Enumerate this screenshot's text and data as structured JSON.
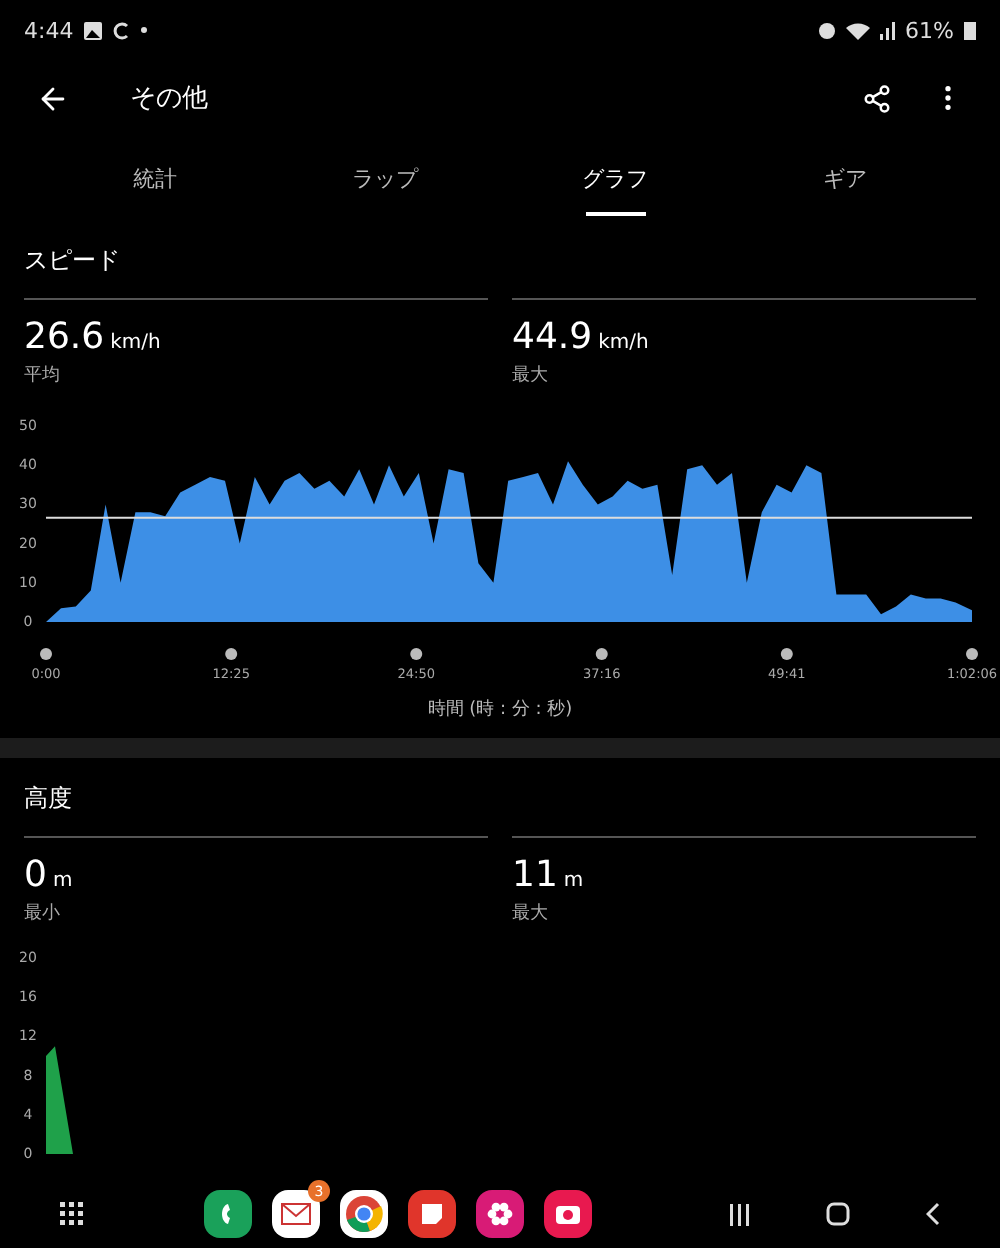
{
  "status_bar": {
    "time": "4:44",
    "battery": "61%"
  },
  "app_bar": {
    "title": "その他"
  },
  "tabs": [
    {
      "label": "統計",
      "selected": false
    },
    {
      "label": "ラップ",
      "selected": false
    },
    {
      "label": "グラフ",
      "selected": true
    },
    {
      "label": "ギア",
      "selected": false
    }
  ],
  "sections": [
    {
      "title": "スピード",
      "stats": [
        {
          "value": "26.6",
          "unit": "km/h",
          "label": "平均"
        },
        {
          "value": "44.9",
          "unit": "km/h",
          "label": "最大"
        }
      ],
      "chart_data": {
        "type": "area",
        "xlabel": "時間 (時 : 分 : 秒)",
        "xlim": [
          0,
          62.1
        ],
        "ylim": [
          0,
          50
        ],
        "yticks": [
          0,
          10,
          20,
          30,
          40,
          50
        ],
        "xticks": [
          {
            "value": 0,
            "label": "0:00"
          },
          {
            "value": 12.42,
            "label": "12:25"
          },
          {
            "value": 24.83,
            "label": "24:50"
          },
          {
            "value": 37.27,
            "label": "37:16"
          },
          {
            "value": 49.68,
            "label": "49:41"
          },
          {
            "value": 62.1,
            "label": "1:02:06"
          }
        ],
        "x": [
          0,
          1,
          2,
          3,
          4,
          5,
          6,
          7,
          8,
          9,
          10,
          11,
          12,
          13,
          14,
          15,
          16,
          17,
          18,
          19,
          20,
          21,
          22,
          23,
          24,
          25,
          26,
          27,
          28,
          29,
          30,
          31,
          32,
          33,
          34,
          35,
          36,
          37,
          38,
          39,
          40,
          41,
          42,
          43,
          44,
          45,
          46,
          47,
          48,
          49,
          50,
          51,
          52,
          53,
          54,
          55,
          56,
          57,
          58,
          59,
          60,
          61,
          62.1
        ],
        "series": [
          {
            "color": "#3d8fe6",
            "values": [
              0,
              3.5,
              4,
              8,
              30,
              10,
              28,
              28,
              27,
              33,
              35,
              37,
              36,
              20,
              37,
              30,
              36,
              38,
              34,
              36,
              32,
              39,
              30,
              40,
              32,
              38,
              20,
              39,
              38,
              15,
              10,
              36,
              37,
              38,
              30,
              41,
              35,
              30,
              32,
              36,
              34,
              35,
              12,
              39,
              40,
              35,
              38,
              10,
              28,
              35,
              33,
              40,
              38,
              7,
              7,
              7,
              2,
              4,
              7,
              6,
              6,
              5,
              3
            ]
          }
        ],
        "ref_lines": [
          {
            "axis": "y",
            "value": 26.6
          }
        ]
      }
    },
    {
      "title": "高度",
      "stats": [
        {
          "value": "0",
          "unit": "m",
          "label": "最小"
        },
        {
          "value": "11",
          "unit": "m",
          "label": "最大"
        }
      ],
      "chart_data": {
        "type": "area",
        "ylim": [
          0,
          20
        ],
        "yticks": [
          0,
          4,
          8,
          12,
          16,
          20
        ],
        "series": [
          {
            "color": "#1fa14a",
            "values": [
              10,
              11,
              5.5,
              0
            ]
          }
        ]
      }
    }
  ],
  "dock": {
    "apps": [
      {
        "kind": "phone",
        "color": "#1aa15a"
      },
      {
        "kind": "mail",
        "color": "#ffffff",
        "badge": "3"
      },
      {
        "kind": "browser",
        "color": "#ffffff"
      },
      {
        "kind": "notes",
        "color": "#e0352b"
      },
      {
        "kind": "flower",
        "color": "#d81b76"
      },
      {
        "kind": "camera",
        "color": "#e8194f"
      }
    ]
  }
}
